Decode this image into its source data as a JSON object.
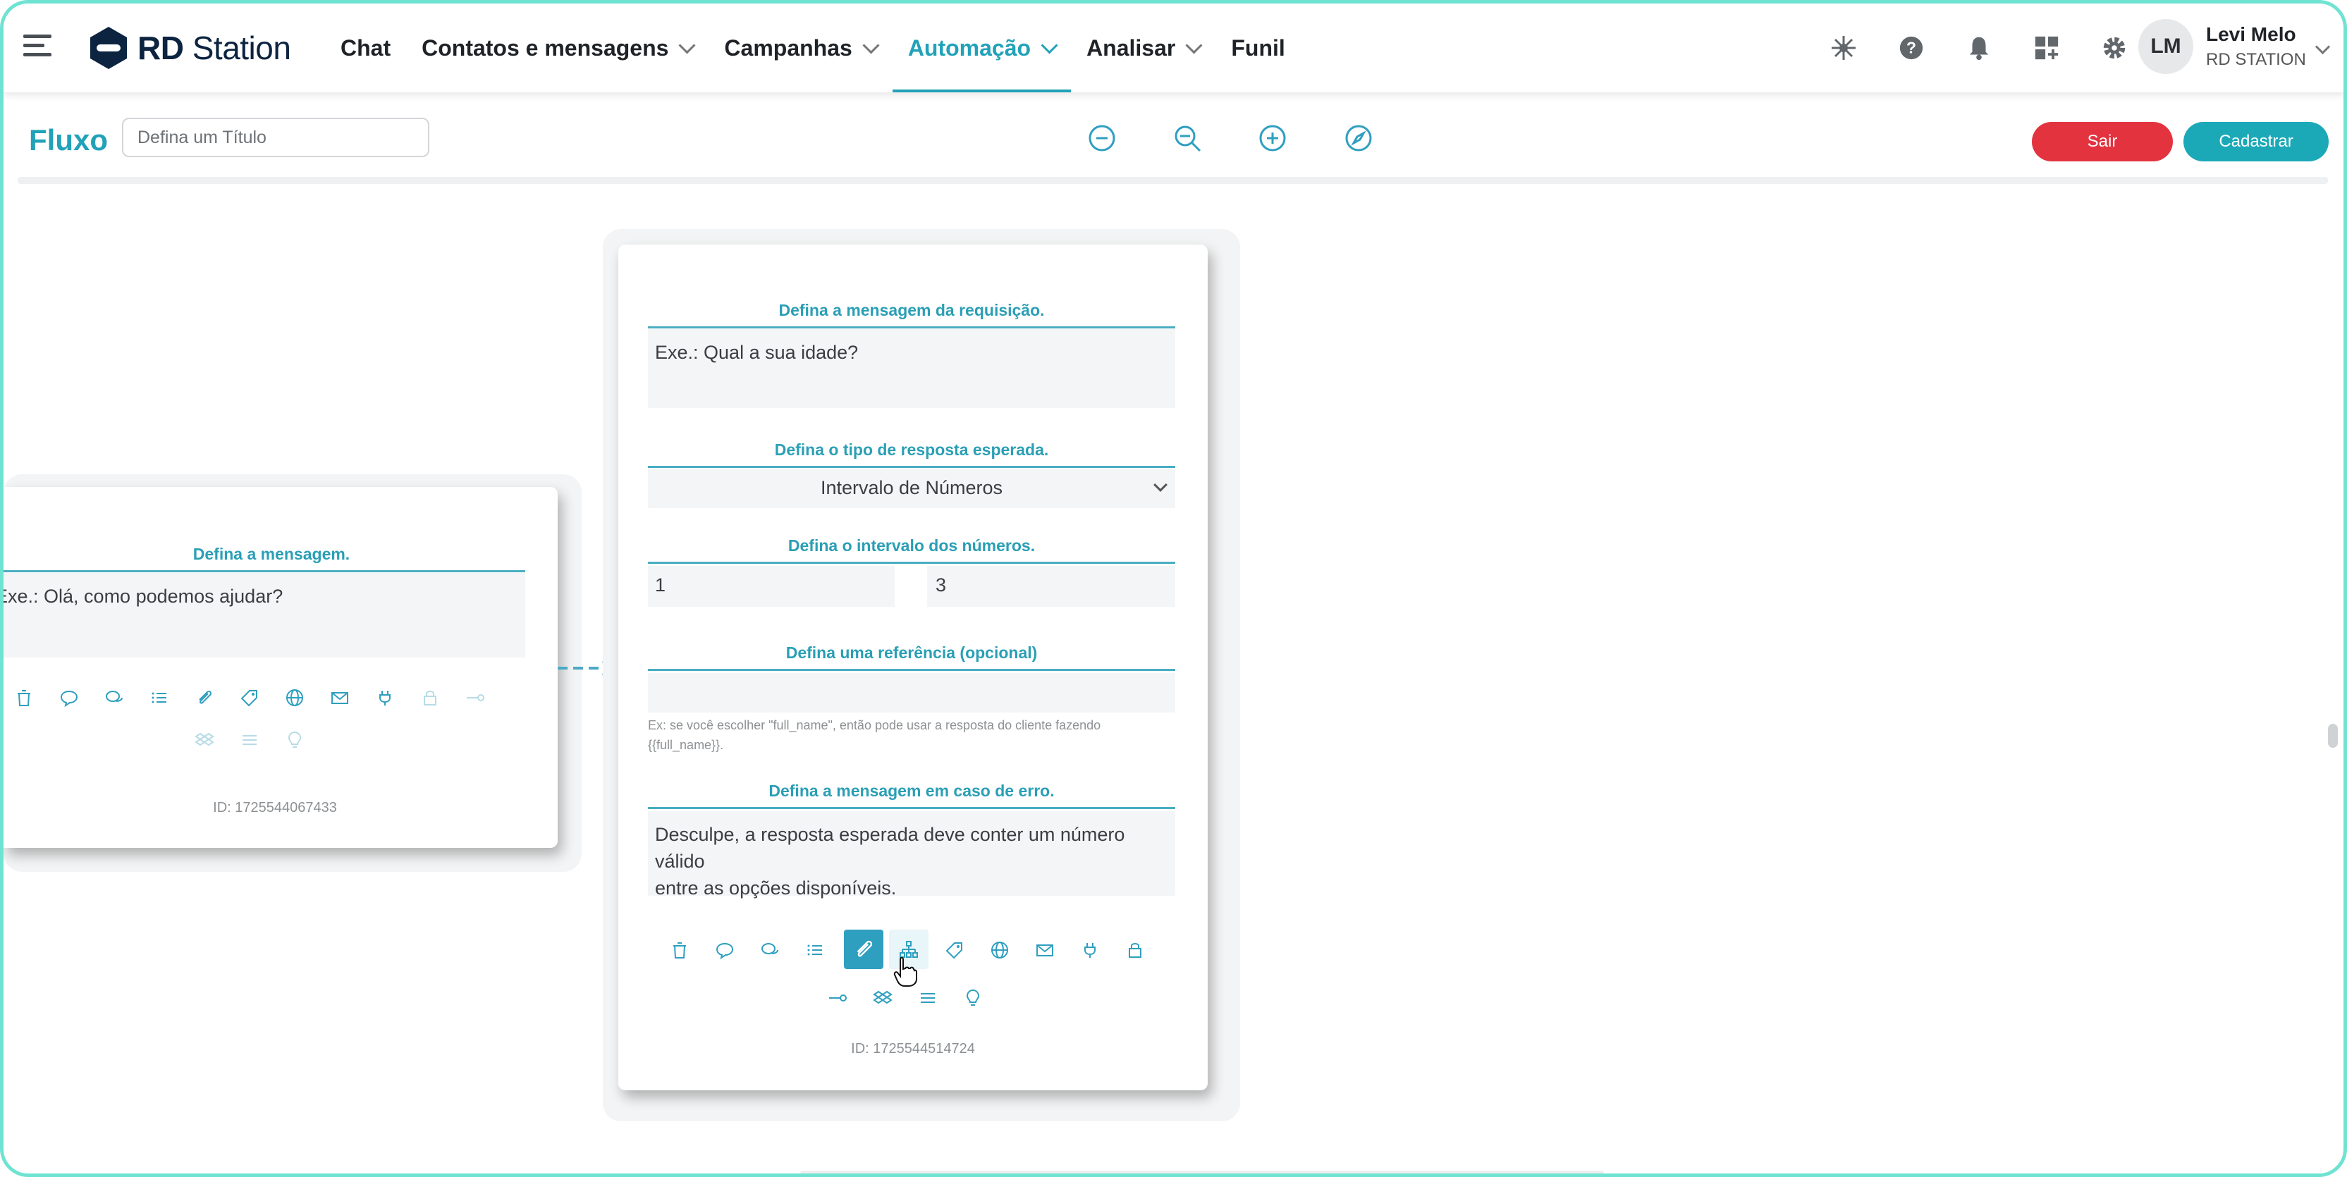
{
  "header": {
    "logo_text_bold": "RD",
    "logo_text_light": "Station",
    "nav": [
      {
        "label": "Chat",
        "has_dropdown": false,
        "active": false
      },
      {
        "label": "Contatos e mensagens",
        "has_dropdown": true,
        "active": false
      },
      {
        "label": "Campanhas",
        "has_dropdown": true,
        "active": false
      },
      {
        "label": "Automação",
        "has_dropdown": true,
        "active": true
      },
      {
        "label": "Analisar",
        "has_dropdown": true,
        "active": false
      },
      {
        "label": "Funil",
        "has_dropdown": false,
        "active": false
      }
    ],
    "icons": [
      "integrations-icon",
      "help-icon",
      "bell-icon",
      "apps-add-icon",
      "gear-icon"
    ],
    "user": {
      "initials": "LM",
      "name": "Levi Melo",
      "org": "RD STATION"
    }
  },
  "toolbar": {
    "flow_label": "Fluxo",
    "title_placeholder": "Defina um Título",
    "zoom_icons": [
      "zoom-reset-icon",
      "zoom-out-icon",
      "zoom-in-icon",
      "compass-icon"
    ],
    "exit_label": "Sair",
    "register_label": "Cadastrar"
  },
  "card_left": {
    "message_title": "Defina a mensagem.",
    "message_placeholder": "Exe.: Olá, como podemos ajudar?",
    "id_text": "ID: 1725544067433"
  },
  "card_main": {
    "request_title": "Defina a mensagem da requisição.",
    "request_placeholder": "Exe.: Qual a sua idade?",
    "response_type_title": "Defina o tipo de resposta esperada.",
    "response_type_value": "Intervalo de Números",
    "range_title": "Defina o intervalo dos números.",
    "range_min": "1",
    "range_max": "3",
    "reference_title": "Defina uma referência (opcional)",
    "reference_hint_line1": "Ex: se você escolher \"full_name\", então pode usar a resposta do cliente fazendo",
    "reference_hint_line2": "{{full_name}}.",
    "error_title": "Defina a mensagem em caso de erro.",
    "error_line1": "Desculpe, a resposta esperada deve conter um número válido",
    "error_line2": "entre as opções disponíveis.",
    "id_text": "ID: 1725544514724"
  },
  "colors": {
    "accent": "#21a2b8",
    "exit": "#e2333f",
    "register": "#1ba9b8",
    "icon": "#2f9fbf"
  }
}
